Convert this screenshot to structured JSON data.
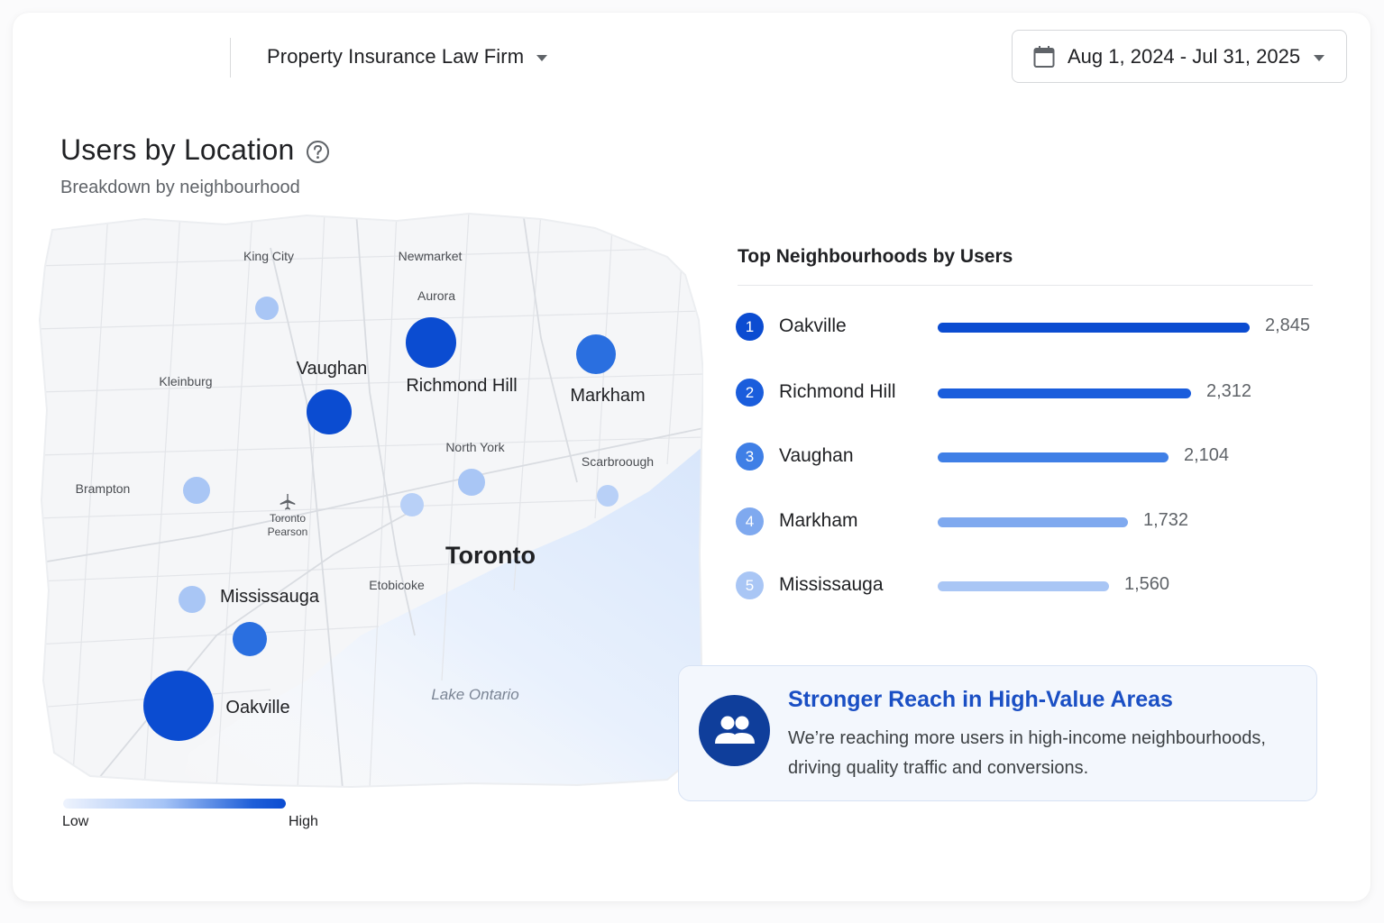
{
  "header": {
    "account_name": "Property Insurance Law Firm",
    "date_range": "Aug 1, 2024 - Jul 31, 2025"
  },
  "widget": {
    "title": "Users by Location",
    "subtitle": "Breakdown by neighbourhood"
  },
  "map": {
    "labels": {
      "king_city": "King City",
      "newmarket": "Newmarket",
      "aurora": "Aurora",
      "kleinburg": "Kleinburg",
      "vaughan": "Vaughan",
      "richmond_hill": "Richmond Hill",
      "markham": "Markham",
      "north_york": "North York",
      "scarborough": "Scarbroough",
      "brampton": "Brampton",
      "toronto_pearson_1": "Toronto",
      "toronto_pearson_2": "Pearson",
      "toronto": "Toronto",
      "etobicoke": "Etobicoke",
      "mississauga": "Mississauga",
      "oakville": "Oakville",
      "lake": "Lake Ontario"
    },
    "legend": {
      "low": "Low",
      "high": "High"
    },
    "colors": {
      "high": "#0b4cd1",
      "mid_high": "#2a6fe0",
      "mid": "#a3c2f5",
      "low": "#b8d0f7"
    }
  },
  "top_list": {
    "title": "Top Neighbourhoods by Users",
    "max_value": 2845,
    "items": [
      {
        "rank": "1",
        "name": "Oakville",
        "value": "2,845",
        "num": 2845,
        "color": "#0b4cd1"
      },
      {
        "rank": "2",
        "name": "Richmond Hill",
        "value": "2,312",
        "num": 2312,
        "color": "#1a5ddc"
      },
      {
        "rank": "3",
        "name": "Vaughan",
        "value": "2,104",
        "num": 2104,
        "color": "#3f7fe6"
      },
      {
        "rank": "4",
        "name": "Markham",
        "value": "1,732",
        "num": 1732,
        "color": "#7fa9ef"
      },
      {
        "rank": "5",
        "name": "Mississauga",
        "value": "1,560",
        "num": 1560,
        "color": "#a9c6f5"
      }
    ]
  },
  "insight": {
    "title": "Stronger Reach in High-Value Areas",
    "text": "We’re reaching more users in high-income neighbourhoods, driving quality traffic and conversions.",
    "icon": "users-icon"
  }
}
